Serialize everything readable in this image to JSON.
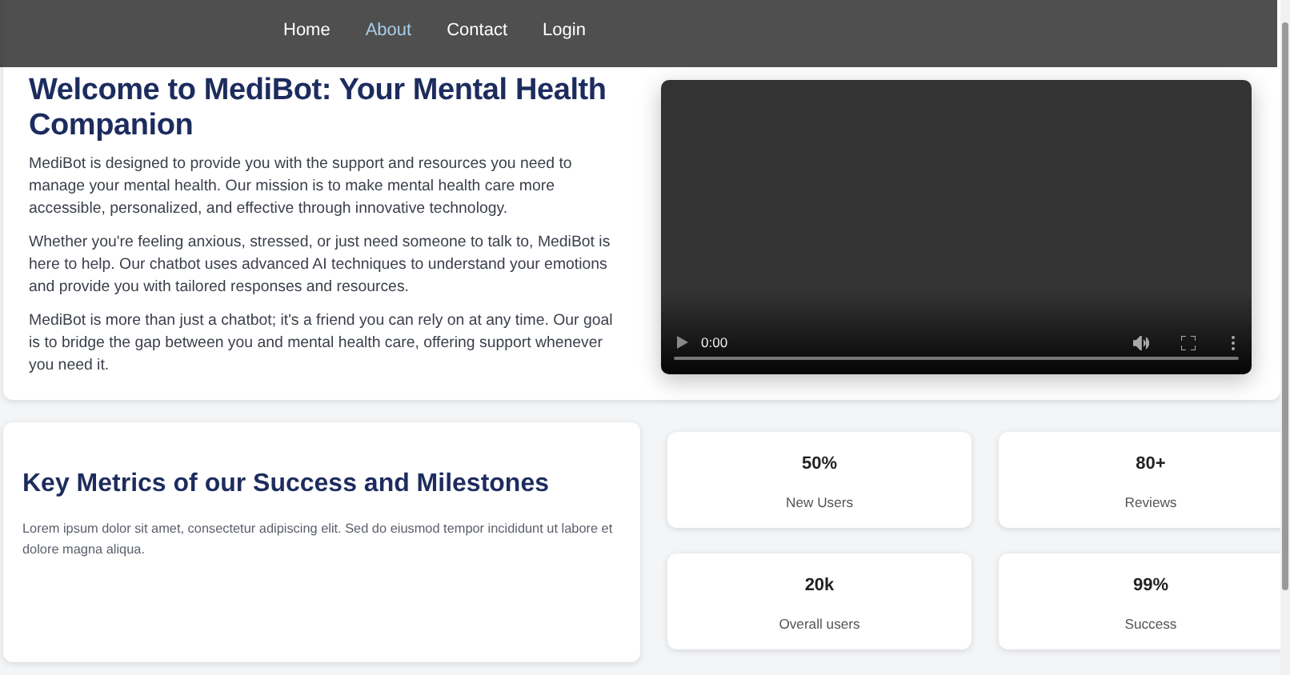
{
  "nav": {
    "links": [
      {
        "label": "Home",
        "selected": false
      },
      {
        "label": "About",
        "selected": true
      },
      {
        "label": "Contact",
        "selected": false
      },
      {
        "label": "Login",
        "selected": false
      }
    ]
  },
  "intro": {
    "title": "Welcome to MediBot: Your Mental Health Companion",
    "paragraphs": [
      "MediBot is designed to provide you with the support and resources you need to manage your mental health. Our mission is to make mental health care more accessible, personalized, and effective through innovative technology.",
      "Whether you're feeling anxious, stressed, or just need someone to talk to, MediBot is here to help. Our chatbot uses advanced AI techniques to understand your emotions and provide you with tailored responses and resources.",
      "MediBot is more than just a chatbot; it's a friend you can rely on at any time. Our goal is to bridge the gap between you and mental health care, offering support whenever you need it."
    ],
    "video": {
      "time": "0:00"
    }
  },
  "metrics": {
    "title": "Key Metrics of our Success and Milestones",
    "text": "Lorem ipsum dolor sit amet, consectetur adipiscing elit. Sed do eiusmod tempor incididunt ut labore et dolore magna aliqua.",
    "stats": [
      {
        "value": "50%",
        "label": "New Users"
      },
      {
        "value": "80+",
        "label": "Reviews"
      },
      {
        "value": "20k",
        "label": "Overall users"
      },
      {
        "value": "99%",
        "label": "Success"
      }
    ]
  }
}
